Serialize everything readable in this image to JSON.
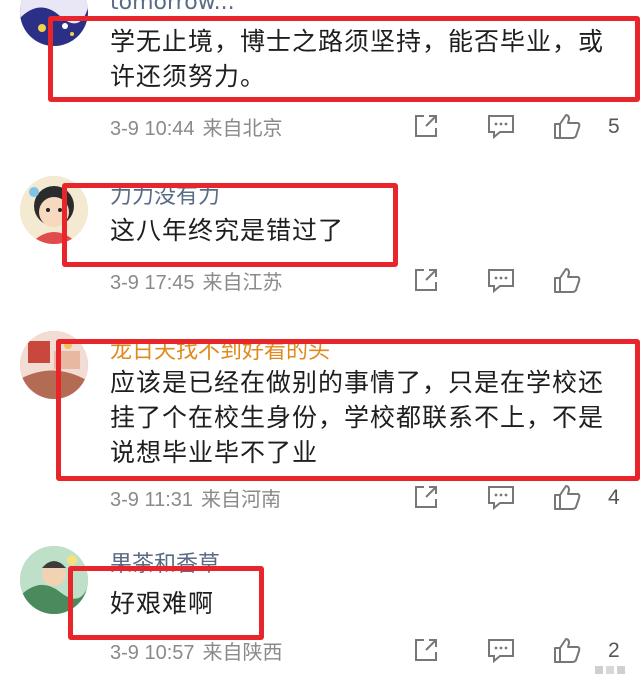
{
  "comments": [
    {
      "username": "tomorrow...",
      "text_lines": [
        "学无止境，博士之路须坚持，能否毕业，或",
        "许还须努力。"
      ],
      "time": "3-9 10:44",
      "location": "来自北京",
      "likes": "5"
    },
    {
      "username": "力力没有力",
      "text_lines": [
        "这八年终究是错过了"
      ],
      "time": "3-9 17:45",
      "location": "来自江苏",
      "likes": ""
    },
    {
      "username": "龙日天找不到好看的头",
      "text_lines": [
        "应该是已经在做别的事情了，只是在学校还",
        "挂了个在校生身份，学校都联系不上，不是",
        "说想毕业毕不了业"
      ],
      "time": "3-9 11:31",
      "location": "来自河南",
      "likes": "4"
    },
    {
      "username": "果茶和香草",
      "text_lines": [
        "好艰难啊"
      ],
      "time": "3-9 10:57",
      "location": "来自陕西",
      "likes": "2"
    }
  ],
  "icons": {
    "share": "share-icon",
    "comment": "comment-icon",
    "like": "thumbs-up-icon"
  },
  "colors": {
    "highlight": "#e8252b",
    "meta": "#8a8a8a",
    "username": "#5a6b85"
  }
}
